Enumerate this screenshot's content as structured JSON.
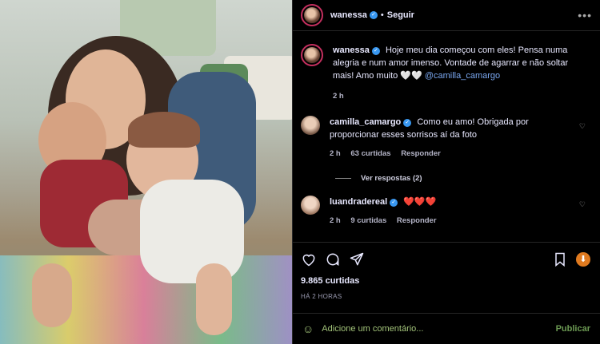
{
  "header": {
    "username": "wanessa",
    "separator": "•",
    "follow_label": "Seguir",
    "more_icon": "more-horizontal-icon"
  },
  "caption": {
    "username": "wanessa",
    "text": "Hoje meu dia começou com eles! Pensa numa alegria e num amor imenso. Vontade de agarrar e não soltar mais! Amo muito 🤍🤍",
    "mention": "@camilla_camargo",
    "time": "2 h"
  },
  "comments": [
    {
      "username": "camilla_camargo",
      "text": "Como eu amo! Obrigada por proporcionar esses sorrisos aí da foto",
      "time": "2 h",
      "likes": "63 curtidas",
      "reply": "Responder",
      "view_replies": "Ver respostas (2)"
    },
    {
      "username": "luandradereal",
      "text": "❤️❤️❤️",
      "time": "2 h",
      "likes": "9 curtidas",
      "reply": "Responder"
    }
  ],
  "post": {
    "likes": "9.865 curtidas",
    "time_ago": "HÁ 2 HORAS"
  },
  "composer": {
    "placeholder": "Adicione um comentário...",
    "publish_label": "Publicar"
  },
  "colors": {
    "accent_link": "#7aa7f0",
    "verified": "#3897f0",
    "publish": "#6c9a53",
    "story_ring": "#c42f5e"
  }
}
